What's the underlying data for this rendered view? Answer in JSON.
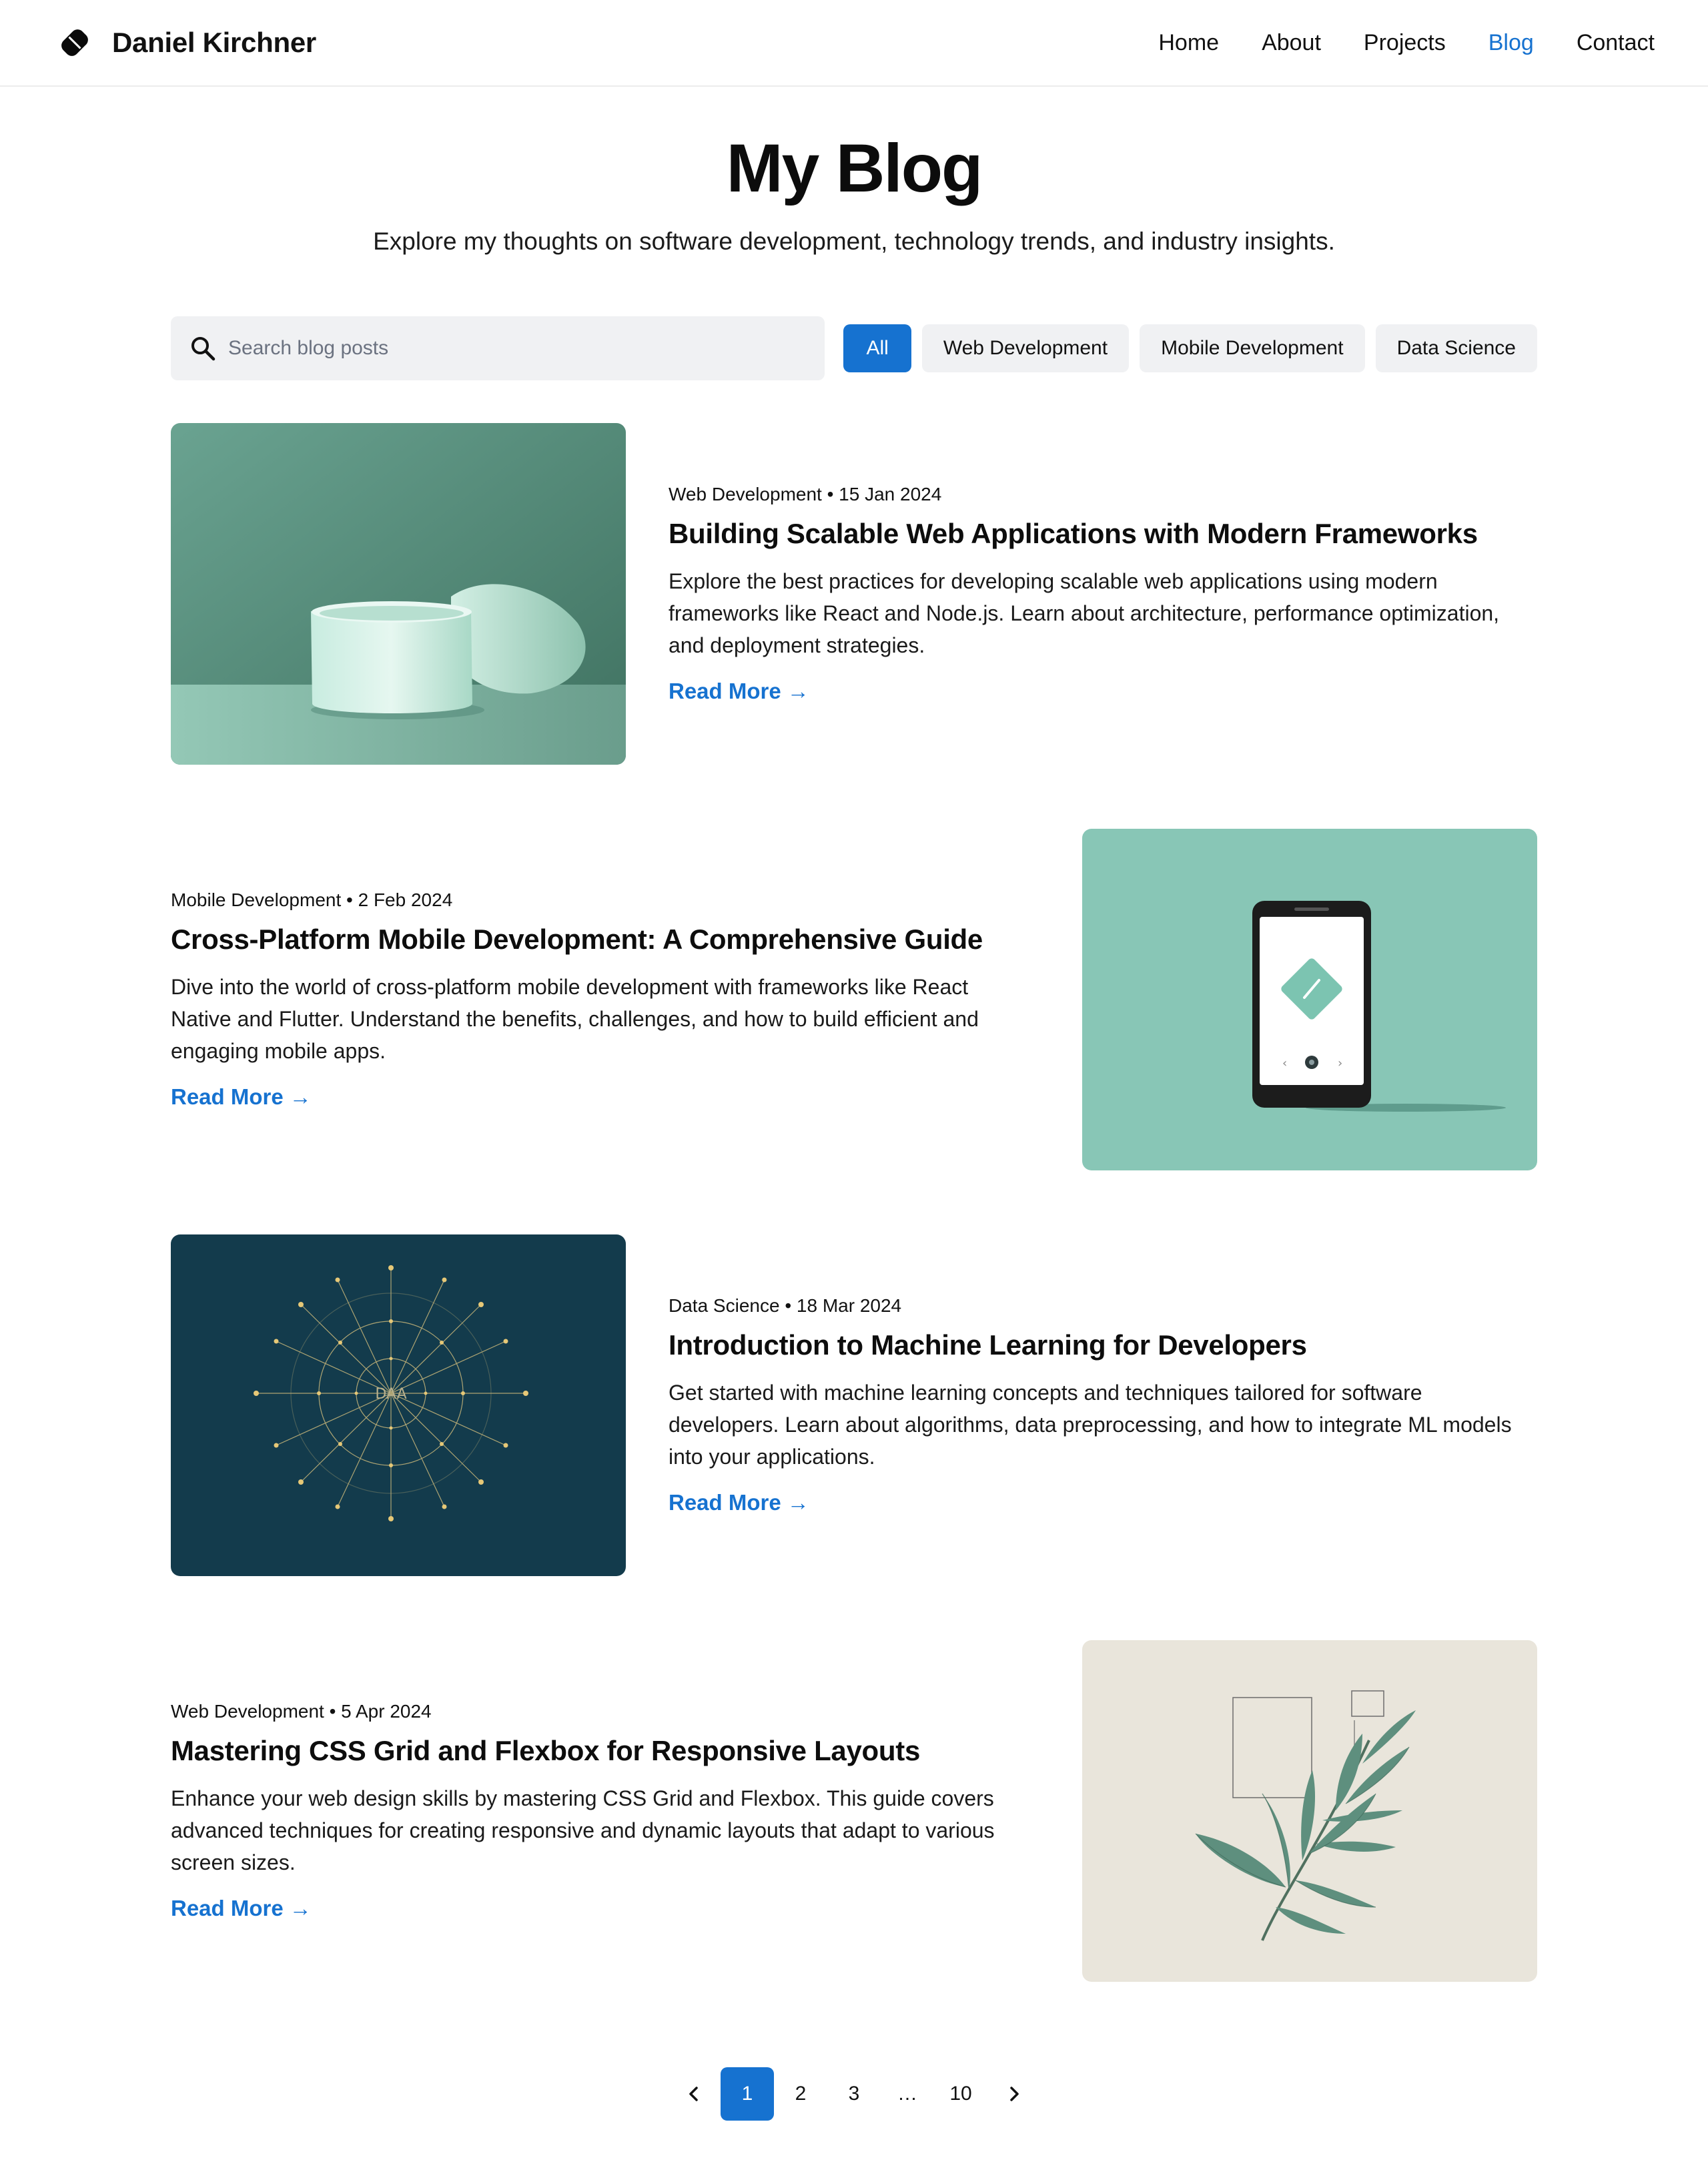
{
  "header": {
    "brand_name": "Daniel Kirchner",
    "nav": [
      {
        "label": "Home",
        "active": false
      },
      {
        "label": "About",
        "active": false
      },
      {
        "label": "Projects",
        "active": false
      },
      {
        "label": "Blog",
        "active": true
      },
      {
        "label": "Contact",
        "active": false
      }
    ]
  },
  "hero": {
    "title": "My Blog",
    "subtitle": "Explore my thoughts on software development, technology trends, and industry insights."
  },
  "search": {
    "placeholder": "Search blog posts",
    "value": ""
  },
  "filters": [
    {
      "label": "All",
      "active": true
    },
    {
      "label": "Web Development",
      "active": false
    },
    {
      "label": "Mobile Development",
      "active": false
    },
    {
      "label": "Data Science",
      "active": false
    }
  ],
  "posts": [
    {
      "meta": "Web Development • 15 Jan 2024",
      "title": "Building Scalable Web Applications with Modern Frameworks",
      "excerpt": "Explore the best practices for developing scalable web applications using modern frameworks like React and Node.js. Learn about architecture, performance optimization, and deployment strategies.",
      "read_more": "Read More →",
      "image": "ceramic-cups-illustration"
    },
    {
      "meta": "Mobile Development • 2 Feb 2024",
      "title": "Cross-Platform Mobile Development: A Comprehensive Guide",
      "excerpt": "Dive into the world of cross-platform mobile development with frameworks like React Native and Flutter. Understand the benefits, challenges, and how to build efficient and engaging mobile apps.",
      "read_more": "Read More →",
      "image": "smartphone-illustration"
    },
    {
      "meta": "Data Science • 18 Mar 2024",
      "title": "Introduction to Machine Learning for Developers",
      "excerpt": "Get started with machine learning concepts and techniques tailored for software developers. Learn about algorithms, data preprocessing, and how to integrate ML models into your applications.",
      "read_more": "Read More →",
      "image": "network-graph-illustration",
      "image_label": "DAA"
    },
    {
      "meta": "Web Development • 5 Apr 2024",
      "title": "Mastering CSS Grid and Flexbox for Responsive Layouts",
      "excerpt": "Enhance your web design skills by mastering CSS Grid and Flexbox. This guide covers advanced techniques for creating responsive and dynamic layouts that adapt to various screen sizes.",
      "read_more": "Read More →",
      "image": "leaf-branch-illustration"
    }
  ],
  "pagination": {
    "pages": [
      "1",
      "2",
      "3",
      "…",
      "10"
    ],
    "current": "1"
  },
  "colors": {
    "accent": "#1672d0",
    "chip_bg": "#f0f1f3",
    "text": "#111111"
  }
}
